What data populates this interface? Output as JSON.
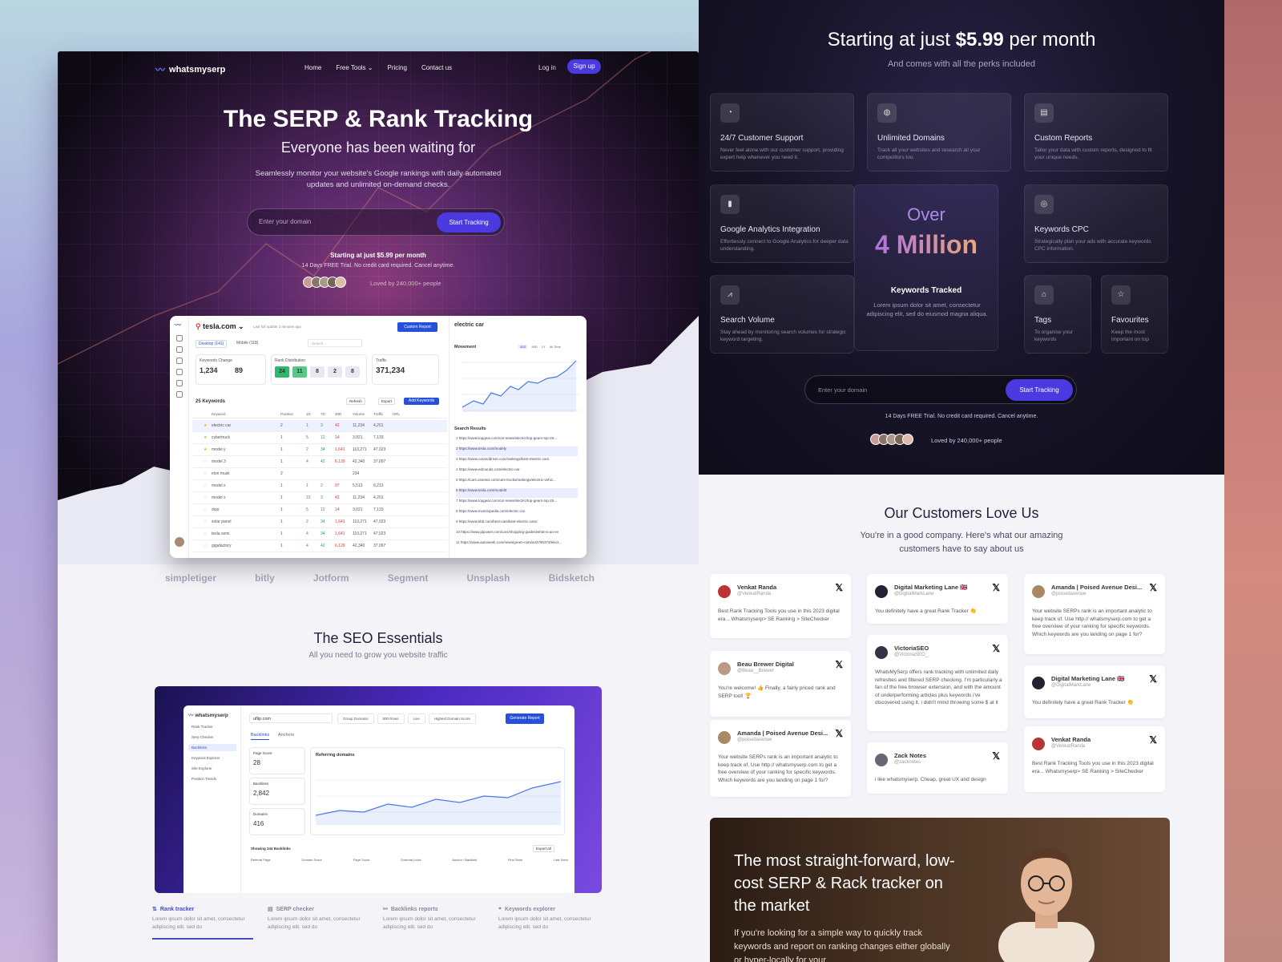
{
  "left": {
    "nav": {
      "logo": "whatsmyserp",
      "links": [
        "Home",
        "Free Tools",
        "Pricing",
        "Contact us"
      ],
      "login": "Log in",
      "signup": "Sign up"
    },
    "hero": {
      "title": "The SERP & Rank Tracking",
      "subtitle": "Everyone has been waiting for",
      "desc": "Seamlessly monitor your website's Google rankings with daily automated updates and unlimited on-demand checks.",
      "placeholder": "Enter your domain",
      "cta": "Start Tracking",
      "price": "Starting at just $5.99 per month",
      "trial": "14 Days FREE Trial. No credit card required. Cancel anytime.",
      "loved": "Loved by 240,000+ people"
    },
    "dashboard": {
      "domain": "tesla.com",
      "updated": "Last full update 2 minutes ago",
      "report_btn": "Custom Report",
      "desktop": "Desktop (141)",
      "mobile": "Mobile (118)",
      "search": "Search...",
      "kw_change": "Keywords Change",
      "kw_change_v1": "1,234",
      "kw_change_v2": "89",
      "rank_dist": "Rank Distribution",
      "dist": [
        "24",
        "11",
        "8",
        "2",
        "8"
      ],
      "traffic": "Traffic",
      "traffic_v": "371,234",
      "kw_count": "25 Keywords",
      "refresh": "Refresh",
      "export": "Export",
      "add": "Add Keywords",
      "cols": [
        "Keyword",
        "Position",
        "1D",
        "7D",
        "30D",
        "Volume",
        "Traffic",
        "URL"
      ],
      "rows": [
        [
          "electric car",
          "2",
          "1",
          "3",
          "42",
          "11,234",
          "4,201"
        ],
        [
          "cybertruck",
          "1",
          "5",
          "12",
          "14",
          "3,021",
          "7,133"
        ],
        [
          "model y",
          "1",
          "2",
          "34",
          "1,641",
          "110,271",
          "47,023"
        ],
        [
          "model 3",
          "1",
          "4",
          "42",
          "6,129",
          "42,340",
          "37,097"
        ],
        [
          "elon musk",
          "2",
          "",
          "",
          "",
          "234",
          ""
        ],
        [
          "model s",
          "1",
          "1",
          "2",
          "97",
          "5,513",
          "6,213"
        ],
        [
          "model x",
          "1",
          "10",
          "3",
          "42",
          "11,234",
          "4,201"
        ],
        [
          "dojo",
          "1",
          "5",
          "12",
          "14",
          "3,021",
          "7,133"
        ],
        [
          "solar panel",
          "1",
          "2",
          "34",
          "1,641",
          "110,271",
          "47,023"
        ],
        [
          "tesla semi",
          "1",
          "4",
          "34",
          "1,641",
          "110,271",
          "47,023"
        ],
        [
          "gigafactory",
          "1",
          "4",
          "42",
          "6,129",
          "42,340",
          "37,097"
        ]
      ],
      "right_kw": "electric car",
      "movement": "Movement",
      "ranges": [
        "30D",
        "90D",
        "1Y",
        "All Time"
      ],
      "results": "Search Results",
      "urls": [
        "https://www.topgear.com/car-news/electric/top-gears-top-25...",
        "https://www.tesla.com/modely",
        "https://www.caranddriver.com/rankings/best-electric-cars",
        "https://www.edmunds.com/electric-car",
        "https://cars.usnews.com/cars-trucks/rankings/electric-vehic...",
        "https://www.tesla.com/model3",
        "https://www.topgear.com/car-news/electric/top-gears-top-25...",
        "https://www.investopedia.com/electric-car",
        "https://www.kbb.com/best-cars/best-electric-cars/",
        "https://www.jdpower.com/cars/shopping-guides/what-is-an-ev",
        "https://www.autoweek.com/news/green-cars/a43790373/elect..."
      ]
    },
    "logos": [
      "simpletiger",
      "bitly",
      "Jotform",
      "Segment",
      "Unsplash",
      "Bidsketch"
    ],
    "seo": {
      "title": "The SEO Essentials",
      "subtitle": "All you need to grow you website traffic",
      "app_logo": "whatsmyserp",
      "side": [
        "Rank Tracker",
        "Serp Checker",
        "Backlinks",
        "Keyword Explorer",
        "Site Explorer",
        "Position Trends"
      ],
      "domain": "uflip.com",
      "filters": [
        "Group Domains",
        "500 Rows",
        "Live",
        "Highest Domain Score"
      ],
      "gen": "Generate Report",
      "tabs": [
        "Backlinks",
        "Anchors"
      ],
      "page_score_label": "Page Score",
      "page_score": "28",
      "backlinks_label": "Backlinks",
      "backlinks": "2,842",
      "domains_label": "Domains",
      "domains": "416",
      "ref_title": "Referring domains",
      "showing": "Showing 344 Backlinks",
      "export_all": "Export all",
      "tcols": [
        "Referral Page",
        "Domain Score",
        "Page Score",
        "External Links",
        "Anchor / Backlink",
        "First Seen",
        "Last Seen"
      ]
    },
    "features": [
      {
        "title": "Rank tracker",
        "desc": "Lorem ipsum dolor sit amet, consectetur adipiscing elit, sed do"
      },
      {
        "title": "SERP checker",
        "desc": "Lorem ipsum dolor sit amet, consectetur adipiscing elit, sed do"
      },
      {
        "title": "Backlinks reports",
        "desc": "Lorem ipsum dolor sit amet, consectetur adipiscing elit, sed do"
      },
      {
        "title": "Keywords explorer",
        "desc": "Lorem ipsum dolor sit amet, consectetur adipiscing elit, sed do"
      }
    ]
  },
  "right": {
    "heading_pre": "Starting at just ",
    "heading_price": "$5.99",
    "heading_post": " per month",
    "sub": "And comes with all the perks included",
    "perks": [
      {
        "title": "24/7 Customer Support",
        "desc": "Never feel alone with our customer support, providing expert help whenever you need it."
      },
      {
        "title": "Unlimited Domains",
        "desc": "Track all your websites and research all your competitors too."
      },
      {
        "title": "Custom Reports",
        "desc": "Tailor your data with custom reports, designed to fit your unique needs."
      },
      {
        "title": "Google Analytics Integration",
        "desc": "Effortlessly connect to Google Analytics for deeper data understanding."
      },
      {
        "title": "Keywords CPC",
        "desc": "Strategically plan your ads with accurate keywords CPC information."
      },
      {
        "title": "Search Volume",
        "desc": "Stay ahead by monitoring search volumes for strategic keyword targeting."
      },
      {
        "title": "Tags",
        "desc": "To organise your keywords"
      },
      {
        "title": "Favourites",
        "desc": "Keep the most important on top"
      }
    ],
    "big": {
      "over": "Over",
      "million": "4 Million",
      "kw": "Keywords Tracked",
      "desc": "Lorem ipsum dolor sit amet, consectetur adipiscing elit, sed do eiusmod magna aliqua."
    },
    "placeholder": "Enter your domain",
    "cta": "Start Tracking",
    "trial": "14 Days FREE Trial. No credit card required. Cancel anytime.",
    "loved": "Loved by 240,000+ people",
    "customers_title": "Our Customers Love Us",
    "customers_sub": "You're in a good company. Here's what our amazing customers have to say about us",
    "tweets": [
      {
        "name": "Venkat Randa",
        "handle": "@VenkatRanda",
        "text": "Best Rank Tracking Tools you use in this 2023 digital era... Whatsmyserp> SE Ranking > SiteChecker"
      },
      {
        "name": "Digital Marketing Lane 🇬🇧",
        "handle": "@DigitalMarkLane",
        "text": "You definitely have a great Rank Tracker 👏"
      },
      {
        "name": "Amanda | Poised Avenue Desi...",
        "handle": "@poisedavenue",
        "text": "Your website SERPs rank is an important analytic to keep track of. Use http:// whatsmyserp.com to get a free overview of your ranking for specific keywords. Which keywords are you landing on page 1 for?"
      },
      {
        "name": "VictoriaSEO",
        "handle": "@VictoriaSEO_",
        "text": "WhatsMySerp offers rank tracking with unlimited daily refreshes and filtered SERP checking. I'm particularly a fan of the free browser extension, and with the amount of underperforming articles plus keywords i've discovered using it, i didn't mind throwing some $ at it"
      },
      {
        "name": "Beau Brewer Digital",
        "handle": "@Beau__Brewer",
        "text": "You're welcome! 👍 Finally, a fairly priced rank and SERP tool! 🏆"
      },
      {
        "name": "Digital Marketing Lane 🇬🇧",
        "handle": "@DigitalMarkLane",
        "text": "You definitely have a great Rank Tracker 👏"
      },
      {
        "name": "Amanda | Poised Avenue Desi...",
        "handle": "@poisedavenue",
        "text": "Your website SERPs rank is an important analytic to keep track of. Use http:// whatsmyserp.com to get a free overview of your ranking for specific keywords. Which keywords are you landing on page 1 for?"
      },
      {
        "name": "Zack Notes",
        "handle": "@zacknotes",
        "text": "i like whatsmyserp. Cheap, great UX and design"
      },
      {
        "name": "Venkat Randa",
        "handle": "@VenkatRanda",
        "text": "Best Rank Tracking Tools you use in this 2023 digital era... Whatsmyserp> SE Ranking > SiteChecker"
      }
    ],
    "promo_title": "The most straight-forward, low-cost SERP & Rack tracker on the market",
    "promo_desc": "If you're looking for a simple way to quickly track keywords and report on ranking changes either globally or hyper-locally for your"
  }
}
